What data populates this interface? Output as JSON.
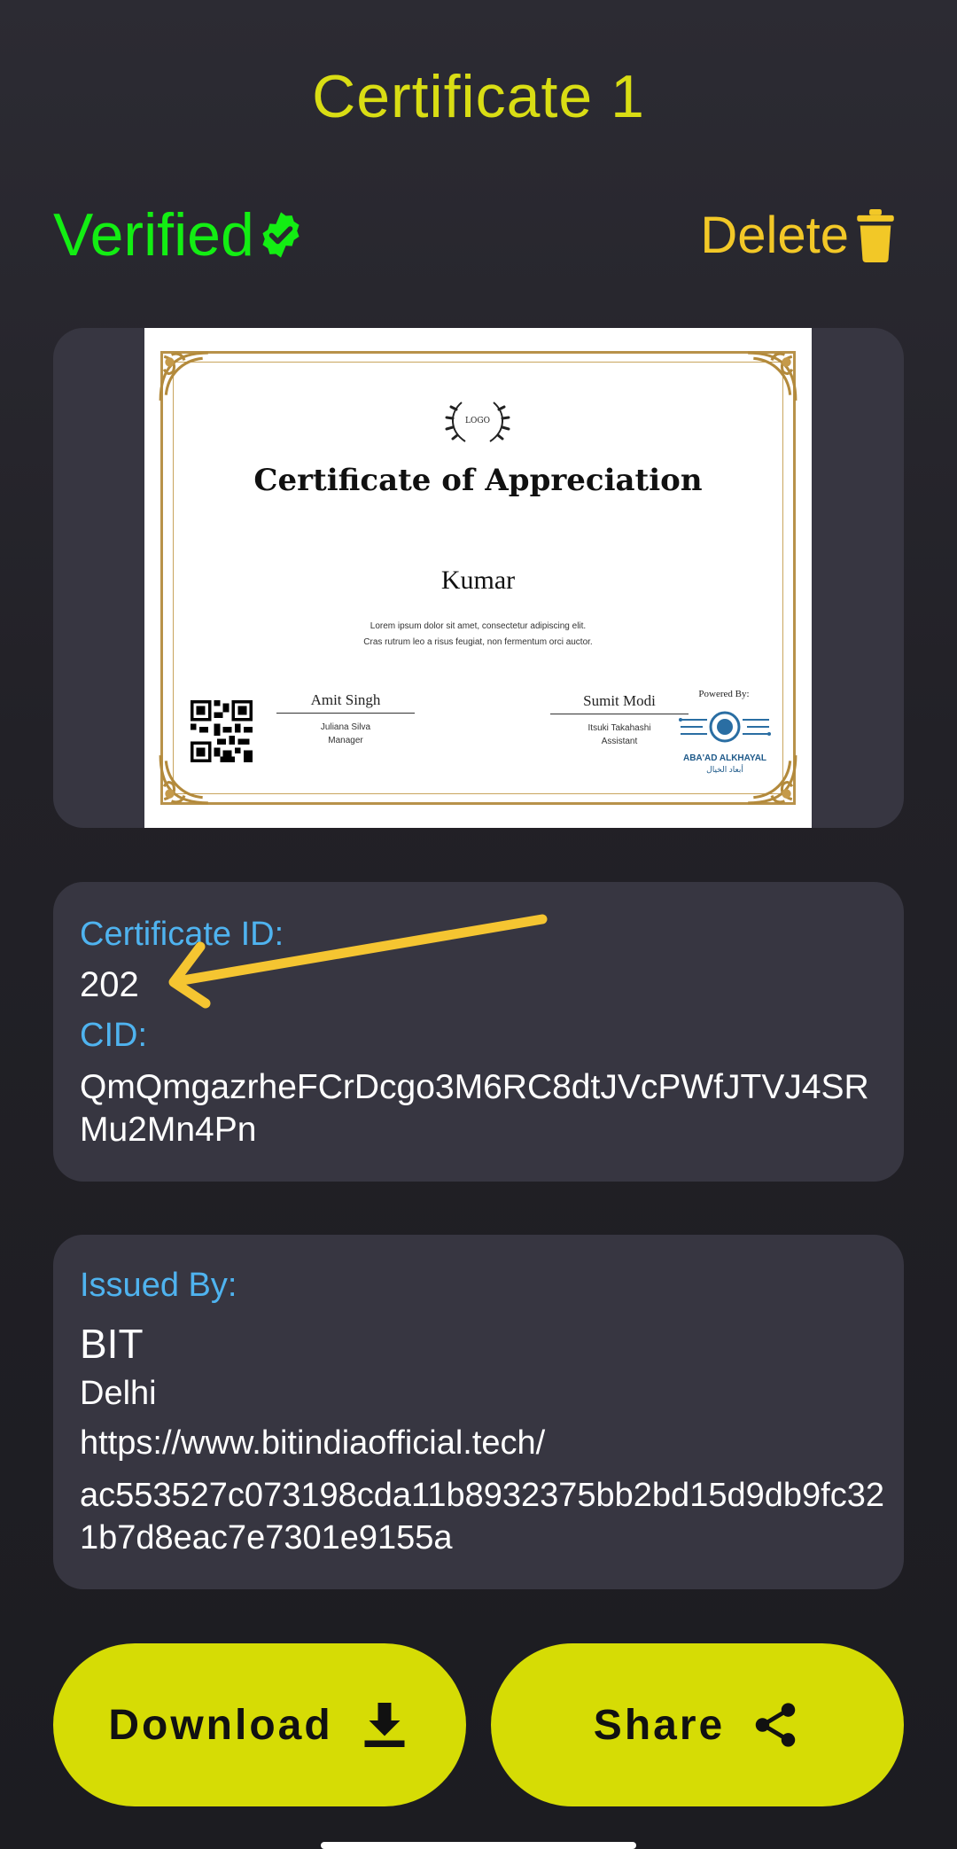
{
  "page": {
    "title": "Certificate 1",
    "verified_label": "Verified",
    "delete_label": "Delete"
  },
  "certificate_preview": {
    "logo_text": "LOGO",
    "heading": "Certificate of Appreciation",
    "recipient": "Kumar",
    "body_line1": "Lorem ipsum dolor sit amet, consectetur adipiscing elit.",
    "body_line2": "Cras rutrum leo a risus feugiat, non fermentum orci auctor.",
    "signatory1": {
      "signature": "Amit Singh",
      "name": "Juliana Silva",
      "role": "Manager"
    },
    "signatory2": {
      "signature": "Sumit Modi",
      "name": "Itsuki Takahashi",
      "role": "Assistant"
    },
    "powered_by": "Powered By:",
    "sponsor_name": "ABA'AD ALKHAYAL",
    "sponsor_arabic": "أبعاد الخيال"
  },
  "details": {
    "certificate_id_label": "Certificate ID:",
    "certificate_id": "202",
    "cid_label": "CID:",
    "cid": "QmQmgazrheFCrDcgo3M6RC8dtJVcPWfJTVJ4SRMu2Mn4Pn"
  },
  "issuer": {
    "label": "Issued By:",
    "name": "BIT",
    "location": "Delhi",
    "url": "https://www.bitindiaofficial.tech/",
    "hash": "ac553527c073198cda11b8932375bb2bd15d9db9fc321b7d8eac7e7301e9155a"
  },
  "actions": {
    "download_label": "Download",
    "share_label": "Share"
  },
  "colors": {
    "title": "#d9dd14",
    "verified": "#13ee13",
    "delete": "#f2c827",
    "label": "#4fb3ef",
    "button": "#d6dc05",
    "card": "#373641",
    "arrow": "#f5c531"
  },
  "icons": [
    "verified-badge-icon",
    "trash-icon",
    "download-icon",
    "share-icon",
    "arrow-annotation"
  ]
}
